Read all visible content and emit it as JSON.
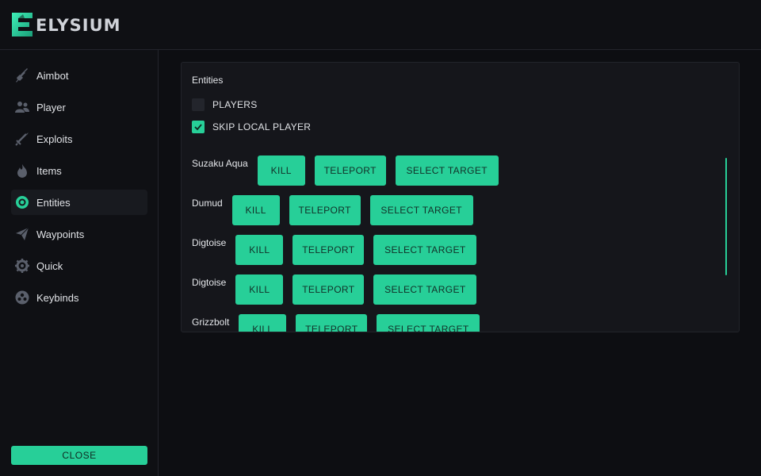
{
  "app": {
    "logo_letter": "E",
    "title": "ELYSIUM"
  },
  "sidebar": {
    "items": [
      {
        "label": "Aimbot",
        "icon": "sword-icon",
        "active": false
      },
      {
        "label": "Player",
        "icon": "users-icon",
        "active": false
      },
      {
        "label": "Exploits",
        "icon": "sword-icon",
        "active": false
      },
      {
        "label": "Items",
        "icon": "fire-icon",
        "active": false
      },
      {
        "label": "Entities",
        "icon": "target-icon",
        "active": true
      },
      {
        "label": "Waypoints",
        "icon": "paper-plane-icon",
        "active": false
      },
      {
        "label": "Quick",
        "icon": "gear-icon",
        "active": false
      },
      {
        "label": "Keybinds",
        "icon": "gamepad-icon",
        "active": false
      }
    ],
    "close_label": "CLOSE"
  },
  "panel": {
    "title": "Entities",
    "options": [
      {
        "label": "PLAYERS",
        "checked": false
      },
      {
        "label": "SKIP LOCAL PLAYER",
        "checked": true
      }
    ],
    "buttons": {
      "kill": "KILL",
      "teleport": "TELEPORT",
      "select": "SELECT TARGET"
    },
    "entities": [
      {
        "name": "Suzaku Aqua"
      },
      {
        "name": "Dumud"
      },
      {
        "name": "Digtoise"
      },
      {
        "name": "Digtoise"
      },
      {
        "name": "Grizzbolt"
      }
    ]
  },
  "colors": {
    "accent": "#27cf98",
    "background": "#0d0e12",
    "panel": "#15161b"
  }
}
